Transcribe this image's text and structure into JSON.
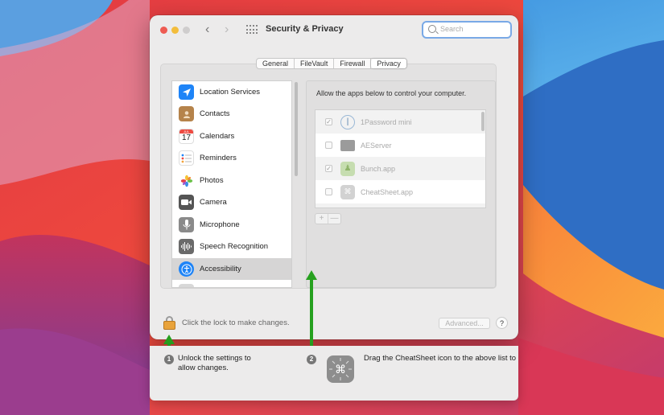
{
  "window": {
    "title": "Security & Privacy",
    "search_placeholder": "Search"
  },
  "tabs": [
    {
      "label": "General",
      "active": false
    },
    {
      "label": "FileVault",
      "active": false
    },
    {
      "label": "Firewall",
      "active": false
    },
    {
      "label": "Privacy",
      "active": true
    }
  ],
  "sidebar": {
    "items": [
      {
        "label": "Location Services",
        "icon": "location-arrow-icon",
        "color": "#1e84f7"
      },
      {
        "label": "Contacts",
        "icon": "contacts-icon",
        "color": "#b5834b"
      },
      {
        "label": "Calendars",
        "icon": "calendar-icon",
        "color": "#ffffff"
      },
      {
        "label": "Reminders",
        "icon": "reminders-icon",
        "color": "#ffffff"
      },
      {
        "label": "Photos",
        "icon": "photos-icon",
        "color": "#ffffff"
      },
      {
        "label": "Camera",
        "icon": "camera-icon",
        "color": "#555555"
      },
      {
        "label": "Microphone",
        "icon": "microphone-icon",
        "color": "#777777"
      },
      {
        "label": "Speech Recognition",
        "icon": "speech-waveform-icon",
        "color": "#666666"
      },
      {
        "label": "Accessibility",
        "icon": "accessibility-icon",
        "color": "#1e84f7",
        "selected": true
      }
    ],
    "calendar_day": "17",
    "calendar_month": "JUL"
  },
  "privacy": {
    "description": "Allow the apps below to control your computer.",
    "apps": [
      {
        "name": "1Password mini",
        "checked": true,
        "icon": "1password-icon"
      },
      {
        "name": "AEServer",
        "checked": false,
        "icon": "aeserver-icon"
      },
      {
        "name": "Bunch.app",
        "checked": true,
        "icon": "bunch-icon"
      },
      {
        "name": "CheatSheet.app",
        "checked": false,
        "icon": "cheatsheet-icon"
      }
    ],
    "add_label": "+",
    "remove_label": "—"
  },
  "footer": {
    "lock_text": "Click the lock to make changes.",
    "advanced_label": "Advanced...",
    "help_label": "?"
  },
  "instructions": {
    "step1_number": "1",
    "step1_line1": "Unlock the settings to",
    "step1_line2": "allow changes.",
    "step2_number": "2",
    "step2_text": "Drag the CheatSheet icon to the above list to g"
  },
  "colors": {
    "arrow": "#27a11f",
    "accent": "#1e84f7"
  }
}
